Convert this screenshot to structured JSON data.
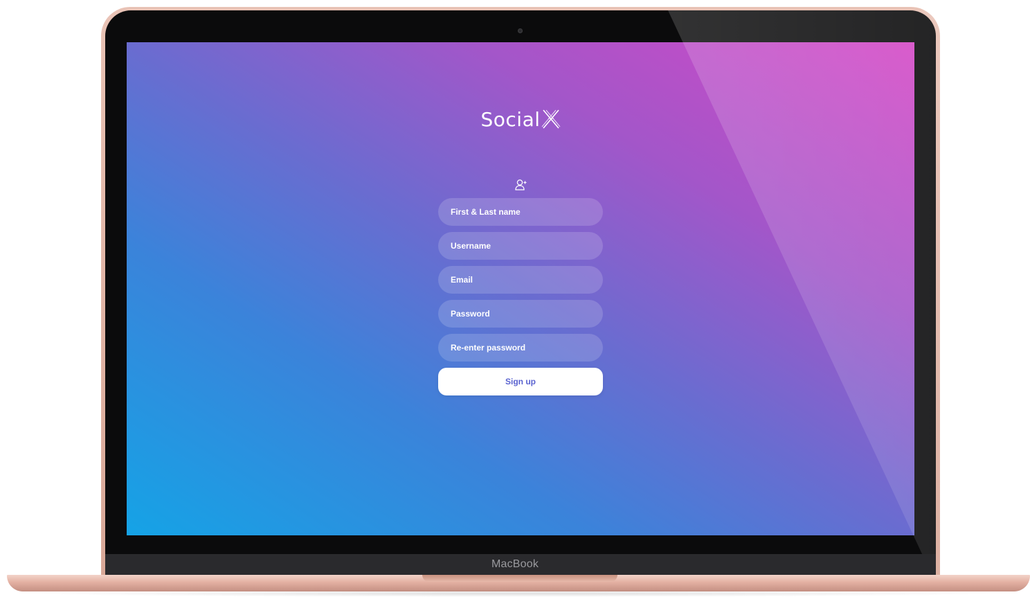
{
  "app": {
    "logo_text": "Social",
    "logo_mark": "X"
  },
  "device": {
    "label": "MacBook"
  },
  "signup_form": {
    "icon": "user-plus-icon",
    "fields": [
      {
        "placeholder": "First & Last name"
      },
      {
        "placeholder": "Username"
      },
      {
        "placeholder": "Email"
      },
      {
        "placeholder": "Password"
      },
      {
        "placeholder": "Re-enter password"
      }
    ],
    "submit_label": "Sign up"
  },
  "colors": {
    "gradient_start": "#15a3e6",
    "gradient_end": "#d548c6",
    "button_text": "#5a63d0",
    "device_shell": "#e3b0a2"
  }
}
